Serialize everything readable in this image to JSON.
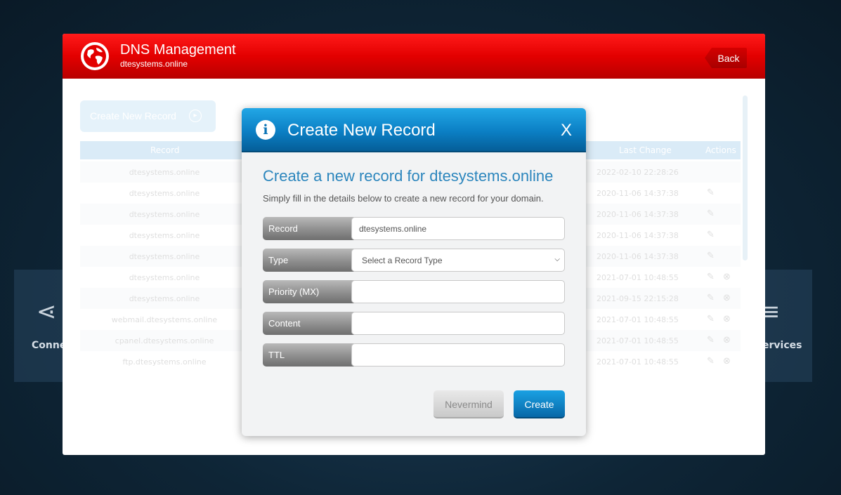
{
  "background": {
    "left_tile_label": "Conne",
    "right_tile_label": "ervices"
  },
  "header": {
    "title": "DNS Management",
    "subtitle": "dtesystems.online",
    "back_label": "Back"
  },
  "toolbar": {
    "create_record_label": "Create New Record"
  },
  "table": {
    "columns": [
      "Record",
      "Last Change",
      "Actions"
    ],
    "rows": [
      {
        "record": "dtesystems.online",
        "last_change": "2022-02-10 22:28:26",
        "actions": ""
      },
      {
        "record": "dtesystems.online",
        "last_change": "2020-11-06 14:37:38",
        "actions": "✎"
      },
      {
        "record": "dtesystems.online",
        "last_change": "2020-11-06 14:37:38",
        "actions": "✎"
      },
      {
        "record": "dtesystems.online",
        "last_change": "2020-11-06 14:37:38",
        "actions": "✎"
      },
      {
        "record": "dtesystems.online",
        "last_change": "2020-11-06 14:37:38",
        "actions": "✎"
      },
      {
        "record": "dtesystems.online",
        "last_change": "2021-07-01 10:48:55",
        "actions": "✎ ⊗"
      },
      {
        "record": "dtesystems.online",
        "last_change": "2021-09-15 22:15:28",
        "actions": "✎ ⊗"
      },
      {
        "record": "webmail.dtesystems.online",
        "last_change": "2021-07-01 10:48:55",
        "actions": "✎ ⊗"
      },
      {
        "record": "cpanel.dtesystems.online",
        "last_change": "2021-07-01 10:48:55",
        "actions": "✎ ⊗"
      },
      {
        "record": "ftp.dtesystems.online",
        "last_change": "2021-07-01 10:48:55",
        "actions": "✎ ⊗"
      }
    ]
  },
  "modal": {
    "title": "Create New Record",
    "close_label": "X",
    "heading": "Create a new record for dtesystems.online",
    "description": "Simply fill in the details below to create a new record for your domain.",
    "fields": {
      "record": {
        "label": "Record",
        "value": "dtesystems.online"
      },
      "type": {
        "label": "Type",
        "selected": "Select a Record Type"
      },
      "priority": {
        "label": "Priority (MX)",
        "value": ""
      },
      "content": {
        "label": "Content",
        "value": ""
      },
      "ttl": {
        "label": "TTL",
        "value": ""
      }
    },
    "nevermind_label": "Nevermind",
    "create_label": "Create"
  },
  "colors": {
    "header_red": "#e30000",
    "modal_blue": "#0b7fc4",
    "heading_blue": "#2c86bd"
  }
}
